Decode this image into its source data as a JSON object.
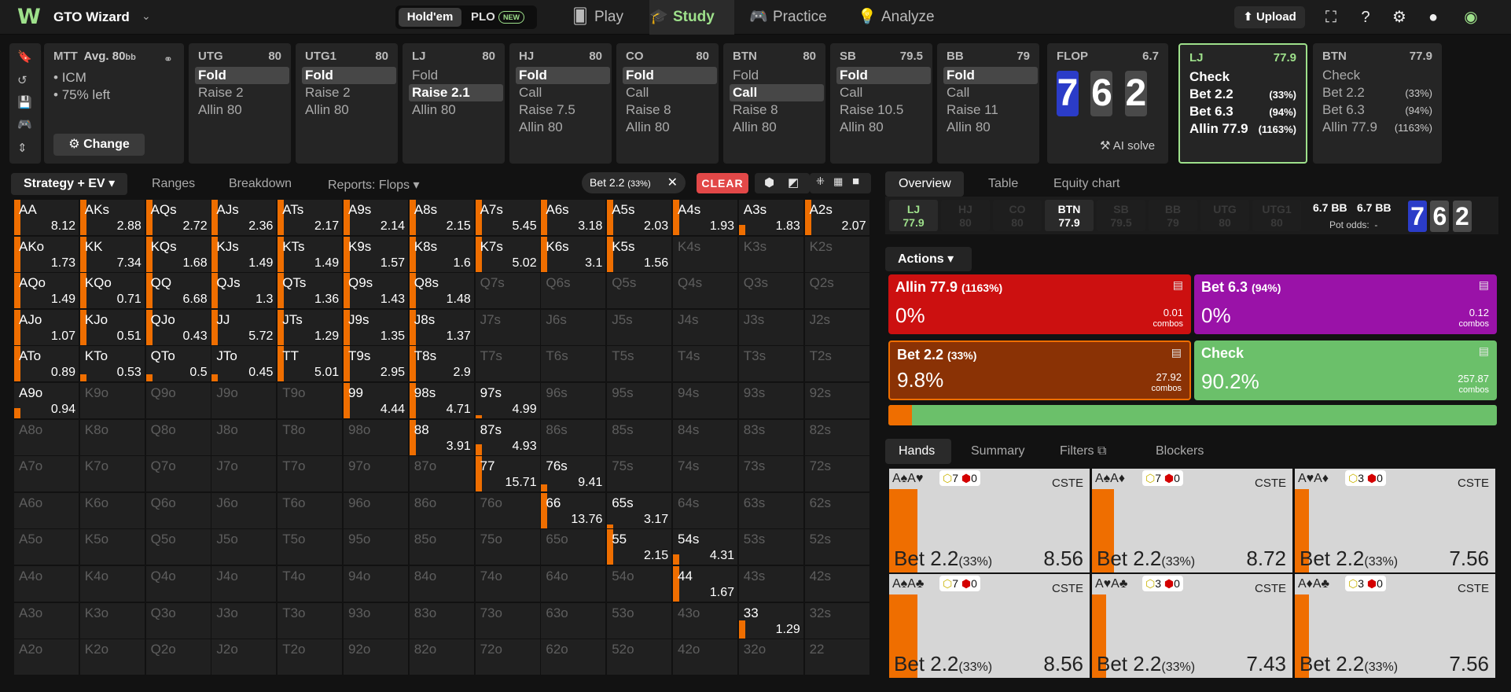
{
  "app": {
    "name": "GTO Wizard",
    "game_tabs": [
      "Hold'em",
      "PLO"
    ],
    "new_badge": "NEW"
  },
  "nav": {
    "tabs": [
      "Play",
      "Study",
      "Practice",
      "Analyze"
    ],
    "active": "Study",
    "upload": "Upload",
    "accent": "#9ee08b"
  },
  "setup": {
    "format": "MTT",
    "avg": "Avg. 80",
    "avg_unit": "bb",
    "bullets": [
      "ICM",
      "75% left"
    ],
    "change": "Change"
  },
  "positions": [
    {
      "name": "UTG",
      "stack": "80",
      "actions": [
        "Fold",
        "Raise 2",
        "Allin 80"
      ],
      "selected": 0
    },
    {
      "name": "UTG1",
      "stack": "80",
      "actions": [
        "Fold",
        "Raise 2",
        "Allin 80"
      ],
      "selected": 0
    },
    {
      "name": "LJ",
      "stack": "80",
      "actions": [
        "Fold",
        "Raise 2.1",
        "Allin 80"
      ],
      "selected": 1
    },
    {
      "name": "HJ",
      "stack": "80",
      "actions": [
        "Fold",
        "Call",
        "Raise 7.5",
        "Allin 80"
      ],
      "selected": 0
    },
    {
      "name": "CO",
      "stack": "80",
      "actions": [
        "Fold",
        "Call",
        "Raise 8",
        "Allin 80"
      ],
      "selected": 0
    },
    {
      "name": "BTN",
      "stack": "80",
      "actions": [
        "Fold",
        "Call",
        "Raise 8",
        "Allin 80"
      ],
      "selected": 1
    },
    {
      "name": "SB",
      "stack": "79.5",
      "actions": [
        "Fold",
        "Call",
        "Raise 10.5",
        "Allin 80"
      ],
      "selected": 0
    },
    {
      "name": "BB",
      "stack": "79",
      "actions": [
        "Fold",
        "Call",
        "Raise 11",
        "Allin 80"
      ],
      "selected": 0
    }
  ],
  "flop": {
    "label": "FLOP",
    "pot": "6.7",
    "cards": [
      "7",
      "6",
      "2"
    ],
    "ai_solve": "AI solve"
  },
  "lj_card": {
    "name": "LJ",
    "stack": "77.9",
    "actions": [
      {
        "label": "Check",
        "pct": ""
      },
      {
        "label": "Bet 2.2",
        "pct": "(33%)"
      },
      {
        "label": "Bet 6.3",
        "pct": "(94%)"
      },
      {
        "label": "Allin 77.9",
        "pct": "(1163%)"
      }
    ]
  },
  "btn_card": {
    "name": "BTN",
    "stack": "77.9",
    "actions": [
      {
        "label": "Check",
        "pct": ""
      },
      {
        "label": "Bet 2.2",
        "pct": "(33%)"
      },
      {
        "label": "Bet 6.3",
        "pct": "(94%)"
      },
      {
        "label": "Allin 77.9",
        "pct": "(1163%)"
      }
    ]
  },
  "toolbar": {
    "strategy": "Strategy + EV",
    "ranges": "Ranges",
    "breakdown": "Breakdown",
    "reports": "Reports: Flops",
    "filter_chip": "Bet 2.2",
    "filter_pct": "(33%)",
    "clear": "CLEAR"
  },
  "grid": {
    "cells": [
      [
        [
          "AA",
          "8.12",
          1
        ],
        [
          "AKs",
          "2.88",
          1
        ],
        [
          "AQs",
          "2.72",
          1
        ],
        [
          "AJs",
          "2.36",
          1
        ],
        [
          "ATs",
          "2.17",
          1
        ],
        [
          "A9s",
          "2.14",
          1
        ],
        [
          "A8s",
          "2.15",
          1
        ],
        [
          "A7s",
          "5.45",
          1
        ],
        [
          "A6s",
          "3.18",
          1
        ],
        [
          "A5s",
          "2.03",
          1
        ],
        [
          "A4s",
          "1.93",
          1
        ],
        [
          "A3s",
          "1.83",
          0.3
        ],
        [
          "A2s",
          "2.07",
          1
        ]
      ],
      [
        [
          "AKo",
          "1.73",
          1
        ],
        [
          "KK",
          "7.34",
          1
        ],
        [
          "KQs",
          "1.68",
          1
        ],
        [
          "KJs",
          "1.49",
          1
        ],
        [
          "KTs",
          "1.49",
          1
        ],
        [
          "K9s",
          "1.57",
          1
        ],
        [
          "K8s",
          "1.6",
          1
        ],
        [
          "K7s",
          "5.02",
          1
        ],
        [
          "K6s",
          "3.1",
          1
        ],
        [
          "K5s",
          "1.56",
          1
        ],
        [
          "K4s",
          "",
          0
        ],
        [
          "K3s",
          "",
          0
        ],
        [
          "K2s",
          "",
          0
        ]
      ],
      [
        [
          "AQo",
          "1.49",
          1
        ],
        [
          "KQo",
          "0.71",
          1
        ],
        [
          "QQ",
          "6.68",
          1
        ],
        [
          "QJs",
          "1.3",
          1
        ],
        [
          "QTs",
          "1.36",
          1
        ],
        [
          "Q9s",
          "1.43",
          1
        ],
        [
          "Q8s",
          "1.48",
          1
        ],
        [
          "Q7s",
          "",
          0
        ],
        [
          "Q6s",
          "",
          0
        ],
        [
          "Q5s",
          "",
          0
        ],
        [
          "Q4s",
          "",
          0
        ],
        [
          "Q3s",
          "",
          0
        ],
        [
          "Q2s",
          "",
          0
        ]
      ],
      [
        [
          "AJo",
          "1.07",
          1
        ],
        [
          "KJo",
          "0.51",
          1
        ],
        [
          "QJo",
          "0.43",
          1
        ],
        [
          "JJ",
          "5.72",
          1
        ],
        [
          "JTs",
          "1.29",
          1
        ],
        [
          "J9s",
          "1.35",
          1
        ],
        [
          "J8s",
          "1.37",
          1
        ],
        [
          "J7s",
          "",
          0
        ],
        [
          "J6s",
          "",
          0
        ],
        [
          "J5s",
          "",
          0
        ],
        [
          "J4s",
          "",
          0
        ],
        [
          "J3s",
          "",
          0
        ],
        [
          "J2s",
          "",
          0
        ]
      ],
      [
        [
          "ATo",
          "0.89",
          1
        ],
        [
          "KTo",
          "0.53",
          0.2
        ],
        [
          "QTo",
          "0.5",
          0.2
        ],
        [
          "JTo",
          "0.45",
          0.2
        ],
        [
          "TT",
          "5.01",
          1
        ],
        [
          "T9s",
          "2.95",
          1
        ],
        [
          "T8s",
          "2.9",
          1
        ],
        [
          "T7s",
          "",
          0
        ],
        [
          "T6s",
          "",
          0
        ],
        [
          "T5s",
          "",
          0
        ],
        [
          "T4s",
          "",
          0
        ],
        [
          "T3s",
          "",
          0
        ],
        [
          "T2s",
          "",
          0
        ]
      ],
      [
        [
          "A9o",
          "0.94",
          0.3
        ],
        [
          "K9o",
          "",
          0
        ],
        [
          "Q9o",
          "",
          0
        ],
        [
          "J9o",
          "",
          0
        ],
        [
          "T9o",
          "",
          0
        ],
        [
          "99",
          "4.44",
          1
        ],
        [
          "98s",
          "4.71",
          1
        ],
        [
          "97s",
          "4.99",
          0.1
        ],
        [
          "96s",
          "",
          0
        ],
        [
          "95s",
          "",
          0
        ],
        [
          "94s",
          "",
          0
        ],
        [
          "93s",
          "",
          0
        ],
        [
          "92s",
          "",
          0
        ]
      ],
      [
        [
          "A8o",
          "",
          0
        ],
        [
          "K8o",
          "",
          0
        ],
        [
          "Q8o",
          "",
          0
        ],
        [
          "J8o",
          "",
          0
        ],
        [
          "T8o",
          "",
          0
        ],
        [
          "98o",
          "",
          0
        ],
        [
          "88",
          "3.91",
          1
        ],
        [
          "87s",
          "4.93",
          0.3
        ],
        [
          "86s",
          "",
          0
        ],
        [
          "85s",
          "",
          0
        ],
        [
          "84s",
          "",
          0
        ],
        [
          "83s",
          "",
          0
        ],
        [
          "82s",
          "",
          0
        ]
      ],
      [
        [
          "A7o",
          "",
          0
        ],
        [
          "K7o",
          "",
          0
        ],
        [
          "Q7o",
          "",
          0
        ],
        [
          "J7o",
          "",
          0
        ],
        [
          "T7o",
          "",
          0
        ],
        [
          "97o",
          "",
          0
        ],
        [
          "87o",
          "",
          0
        ],
        [
          "77",
          "15.71",
          1
        ],
        [
          "76s",
          "9.41",
          0.2
        ],
        [
          "75s",
          "",
          0
        ],
        [
          "74s",
          "",
          0
        ],
        [
          "73s",
          "",
          0
        ],
        [
          "72s",
          "",
          0
        ]
      ],
      [
        [
          "A6o",
          "",
          0
        ],
        [
          "K6o",
          "",
          0
        ],
        [
          "Q6o",
          "",
          0
        ],
        [
          "J6o",
          "",
          0
        ],
        [
          "T6o",
          "",
          0
        ],
        [
          "96o",
          "",
          0
        ],
        [
          "86o",
          "",
          0
        ],
        [
          "76o",
          "",
          0
        ],
        [
          "66",
          "13.76",
          1
        ],
        [
          "65s",
          "3.17",
          0.1
        ],
        [
          "64s",
          "",
          0
        ],
        [
          "63s",
          "",
          0
        ],
        [
          "62s",
          "",
          0
        ]
      ],
      [
        [
          "A5o",
          "",
          0
        ],
        [
          "K5o",
          "",
          0
        ],
        [
          "Q5o",
          "",
          0
        ],
        [
          "J5o",
          "",
          0
        ],
        [
          "T5o",
          "",
          0
        ],
        [
          "95o",
          "",
          0
        ],
        [
          "85o",
          "",
          0
        ],
        [
          "75o",
          "",
          0
        ],
        [
          "65o",
          "",
          0
        ],
        [
          "55",
          "2.15",
          1
        ],
        [
          "54s",
          "4.31",
          0.3
        ],
        [
          "53s",
          "",
          0
        ],
        [
          "52s",
          "",
          0
        ]
      ],
      [
        [
          "A4o",
          "",
          0
        ],
        [
          "K4o",
          "",
          0
        ],
        [
          "Q4o",
          "",
          0
        ],
        [
          "J4o",
          "",
          0
        ],
        [
          "T4o",
          "",
          0
        ],
        [
          "94o",
          "",
          0
        ],
        [
          "84o",
          "",
          0
        ],
        [
          "74o",
          "",
          0
        ],
        [
          "64o",
          "",
          0
        ],
        [
          "54o",
          "",
          0
        ],
        [
          "44",
          "1.67",
          1
        ],
        [
          "43s",
          "",
          0
        ],
        [
          "42s",
          "",
          0
        ]
      ],
      [
        [
          "A3o",
          "",
          0
        ],
        [
          "K3o",
          "",
          0
        ],
        [
          "Q3o",
          "",
          0
        ],
        [
          "J3o",
          "",
          0
        ],
        [
          "T3o",
          "",
          0
        ],
        [
          "93o",
          "",
          0
        ],
        [
          "83o",
          "",
          0
        ],
        [
          "73o",
          "",
          0
        ],
        [
          "63o",
          "",
          0
        ],
        [
          "53o",
          "",
          0
        ],
        [
          "43o",
          "",
          0
        ],
        [
          "33",
          "1.29",
          0.5
        ],
        [
          "32s",
          "",
          0
        ]
      ],
      [
        [
          "A2o",
          "",
          0
        ],
        [
          "K2o",
          "",
          0
        ],
        [
          "Q2o",
          "",
          0
        ],
        [
          "J2o",
          "",
          0
        ],
        [
          "T2o",
          "",
          0
        ],
        [
          "92o",
          "",
          0
        ],
        [
          "82o",
          "",
          0
        ],
        [
          "72o",
          "",
          0
        ],
        [
          "62o",
          "",
          0
        ],
        [
          "52o",
          "",
          0
        ],
        [
          "42o",
          "",
          0
        ],
        [
          "32o",
          "",
          0
        ],
        [
          "22",
          "",
          0
        ]
      ]
    ]
  },
  "right_tabs": {
    "top": [
      "Overview",
      "Table",
      "Equity chart"
    ],
    "bottom": [
      "Hands",
      "Summary",
      "Filters",
      "Blockers"
    ]
  },
  "seats": [
    {
      "name": "LJ",
      "stack": "77.9",
      "state": "hero"
    },
    {
      "name": "HJ",
      "stack": "80",
      "state": "folded"
    },
    {
      "name": "CO",
      "stack": "80",
      "state": "folded"
    },
    {
      "name": "BTN",
      "stack": "77.9",
      "state": "active"
    },
    {
      "name": "SB",
      "stack": "79.5",
      "state": "folded"
    },
    {
      "name": "BB",
      "stack": "79",
      "state": "folded"
    },
    {
      "name": "UTG",
      "stack": "80",
      "state": "folded"
    },
    {
      "name": "UTG1",
      "stack": "80",
      "state": "folded"
    }
  ],
  "pot": {
    "a": "6.7 BB",
    "b": "6.7 BB",
    "odds_label": "Pot odds:",
    "odds_value": "-"
  },
  "actions_menu": "Actions",
  "actions_summary": [
    {
      "label": "Allin 77.9",
      "pct": "(1163%)",
      "freq": "0%",
      "combos": "0.01",
      "color": "#cc1010"
    },
    {
      "label": "Bet 6.3",
      "pct": "(94%)",
      "freq": "0%",
      "combos": "0.12",
      "color": "#9a12a8"
    },
    {
      "label": "Bet 2.2",
      "pct": "(33%)",
      "freq": "9.8%",
      "combos": "27.92",
      "color": "#8a3205"
    },
    {
      "label": "Check",
      "pct": "",
      "freq": "90.2%",
      "combos": "257.87",
      "color": "#6bc06a"
    }
  ],
  "combos_word": "combos",
  "freq_bar": {
    "bet": 0.039,
    "check": 0.961
  },
  "hands": [
    {
      "cards": "A♠A♥",
      "a": "7",
      "b": "0",
      "tag": "CSTE",
      "label": "Bet 2.2",
      "pct": "(33%)",
      "ev": "8.56",
      "bar": 0.14
    },
    {
      "cards": "A♠A♦",
      "a": "7",
      "b": "0",
      "tag": "CSTE",
      "label": "Bet 2.2",
      "pct": "(33%)",
      "ev": "8.72",
      "bar": 0.11
    },
    {
      "cards": "A♥A♦",
      "a": "3",
      "b": "0",
      "tag": "CSTE",
      "label": "Bet 2.2",
      "pct": "(33%)",
      "ev": "7.56",
      "bar": 0.07
    },
    {
      "cards": "A♠A♣",
      "a": "7",
      "b": "0",
      "tag": "CSTE",
      "label": "Bet 2.2",
      "pct": "(33%)",
      "ev": "8.56",
      "bar": 0.14
    },
    {
      "cards": "A♥A♣",
      "a": "3",
      "b": "0",
      "tag": "CSTE",
      "label": "Bet 2.2",
      "pct": "(33%)",
      "ev": "7.43",
      "bar": 0.07
    },
    {
      "cards": "A♦A♣",
      "a": "3",
      "b": "0",
      "tag": "CSTE",
      "label": "Bet 2.2",
      "pct": "(33%)",
      "ev": "7.56",
      "bar": 0.07
    }
  ]
}
